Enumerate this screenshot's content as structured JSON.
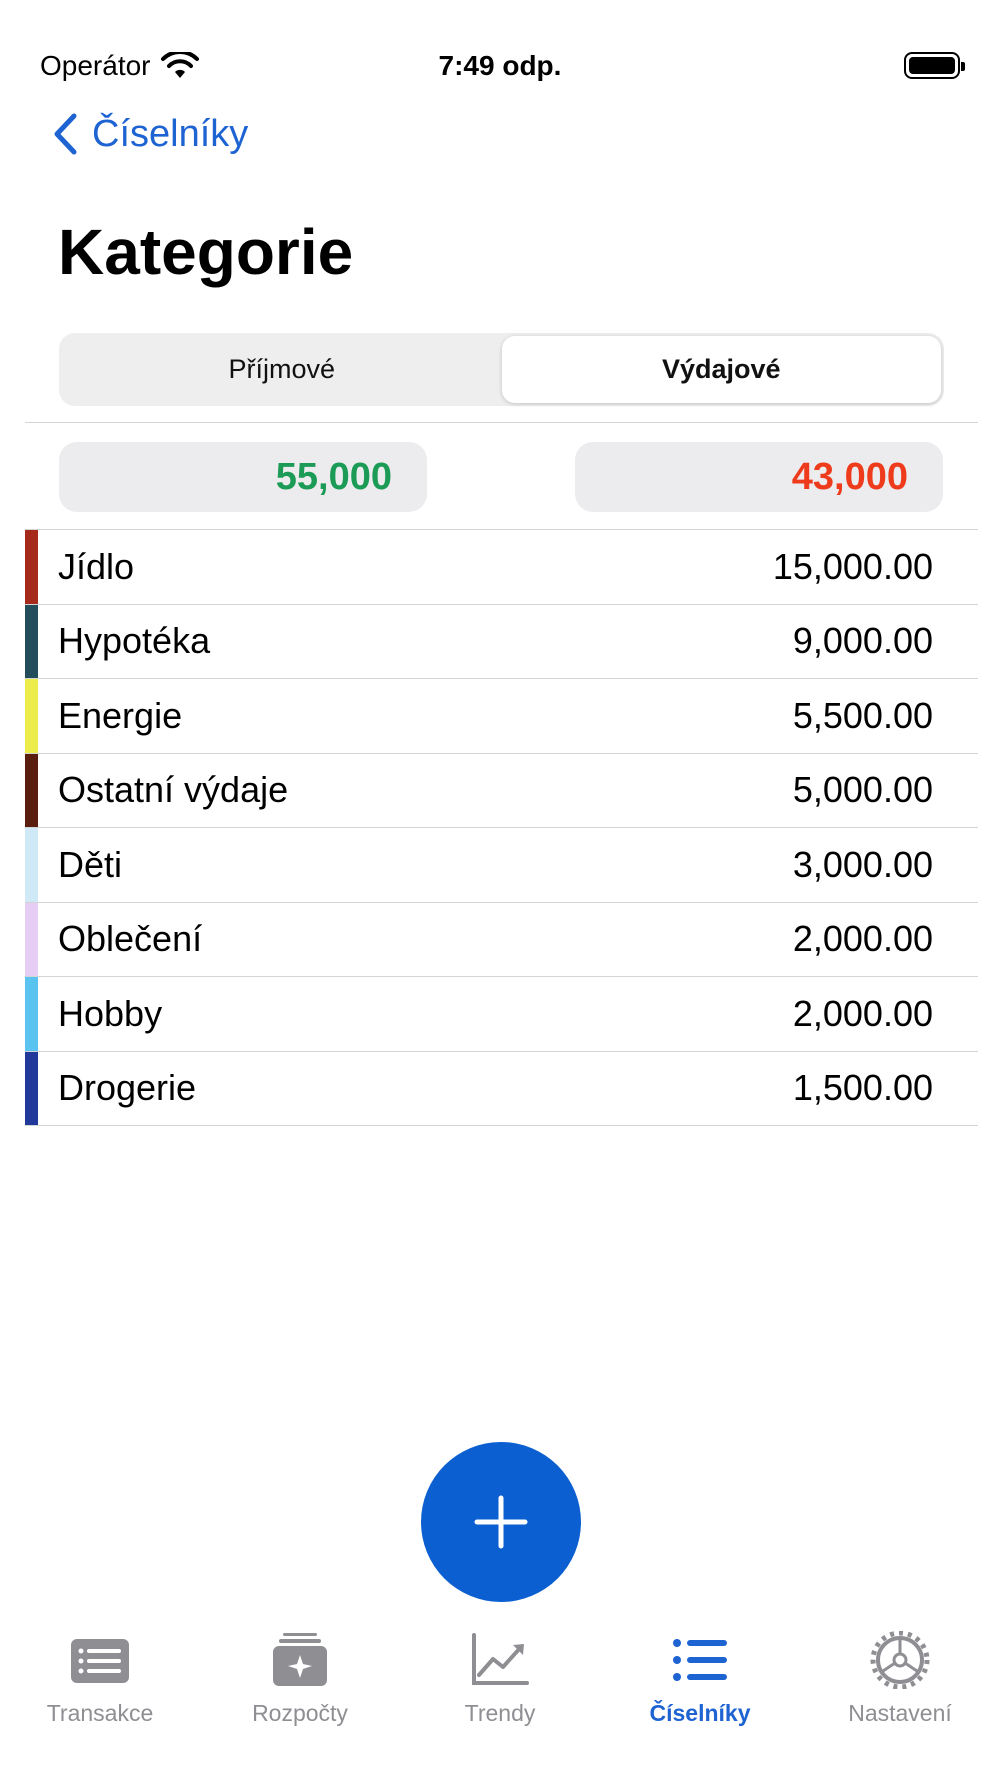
{
  "status_bar": {
    "carrier": "Operátor",
    "time": "7:49 odp."
  },
  "nav": {
    "back_label": "Číselníky",
    "title": "Kategorie"
  },
  "segments": [
    {
      "label": "Příjmové",
      "active": false
    },
    {
      "label": "Výdajové",
      "active": true
    }
  ],
  "totals": {
    "income": "55,000",
    "expense": "43,000",
    "income_color": "#1c9b57",
    "expense_color": "#ee3b1c"
  },
  "categories": [
    {
      "name": "Jídlo",
      "amount": "15,000.00",
      "color": "#a52a1c"
    },
    {
      "name": "Hypotéka",
      "amount": "9,000.00",
      "color": "#244d5c"
    },
    {
      "name": "Energie",
      "amount": "5,500.00",
      "color": "#ecec4a"
    },
    {
      "name": "Ostatní výdaje",
      "amount": "5,000.00",
      "color": "#5a1e0e"
    },
    {
      "name": "Děti",
      "amount": "3,000.00",
      "color": "#cfeaf6"
    },
    {
      "name": "Oblečení",
      "amount": "2,000.00",
      "color": "#e6cdf3"
    },
    {
      "name": "Hobby",
      "amount": "2,000.00",
      "color": "#5ac3ef"
    },
    {
      "name": "Drogerie",
      "amount": "1,500.00",
      "color": "#20399b"
    }
  ],
  "fab": {
    "icon": "plus-icon",
    "color": "#0b5fd0"
  },
  "tabs": [
    {
      "label": "Transakce",
      "icon": "list-card-icon",
      "active": false
    },
    {
      "label": "Rozpočty",
      "icon": "budget-stack-icon",
      "active": false
    },
    {
      "label": "Trendy",
      "icon": "chart-line-icon",
      "active": false
    },
    {
      "label": "Číselníky",
      "icon": "bullet-list-icon",
      "active": true
    },
    {
      "label": "Nastavení",
      "icon": "gear-icon",
      "active": false
    }
  ],
  "accent_color": "#1e63d2"
}
